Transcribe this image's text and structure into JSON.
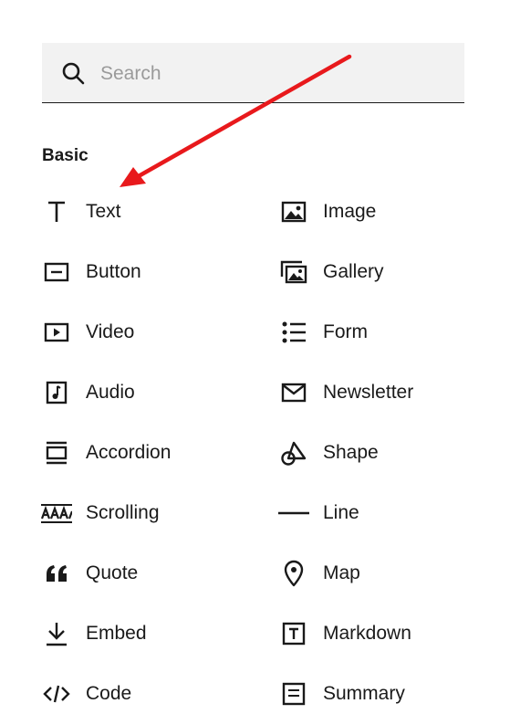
{
  "search": {
    "placeholder": "Search",
    "value": ""
  },
  "section_title": "Basic",
  "blocks": [
    {
      "left": {
        "label": "Text",
        "icon": "text-icon"
      },
      "right": {
        "label": "Image",
        "icon": "image-icon"
      }
    },
    {
      "left": {
        "label": "Button",
        "icon": "button-icon"
      },
      "right": {
        "label": "Gallery",
        "icon": "gallery-icon"
      }
    },
    {
      "left": {
        "label": "Video",
        "icon": "video-icon"
      },
      "right": {
        "label": "Form",
        "icon": "form-icon"
      }
    },
    {
      "left": {
        "label": "Audio",
        "icon": "audio-icon"
      },
      "right": {
        "label": "Newsletter",
        "icon": "envelope-icon"
      }
    },
    {
      "left": {
        "label": "Accordion",
        "icon": "accordion-icon"
      },
      "right": {
        "label": "Shape",
        "icon": "shape-icon"
      }
    },
    {
      "left": {
        "label": "Scrolling",
        "icon": "scrolling-icon"
      },
      "right": {
        "label": "Line",
        "icon": "line-icon"
      }
    },
    {
      "left": {
        "label": "Quote",
        "icon": "quote-icon"
      },
      "right": {
        "label": "Map",
        "icon": "map-pin-icon"
      }
    },
    {
      "left": {
        "label": "Embed",
        "icon": "embed-icon"
      },
      "right": {
        "label": "Markdown",
        "icon": "markdown-icon"
      }
    },
    {
      "left": {
        "label": "Code",
        "icon": "code-icon"
      },
      "right": {
        "label": "Summary",
        "icon": "summary-icon"
      }
    }
  ],
  "annotation": {
    "color": "#e8191c"
  }
}
